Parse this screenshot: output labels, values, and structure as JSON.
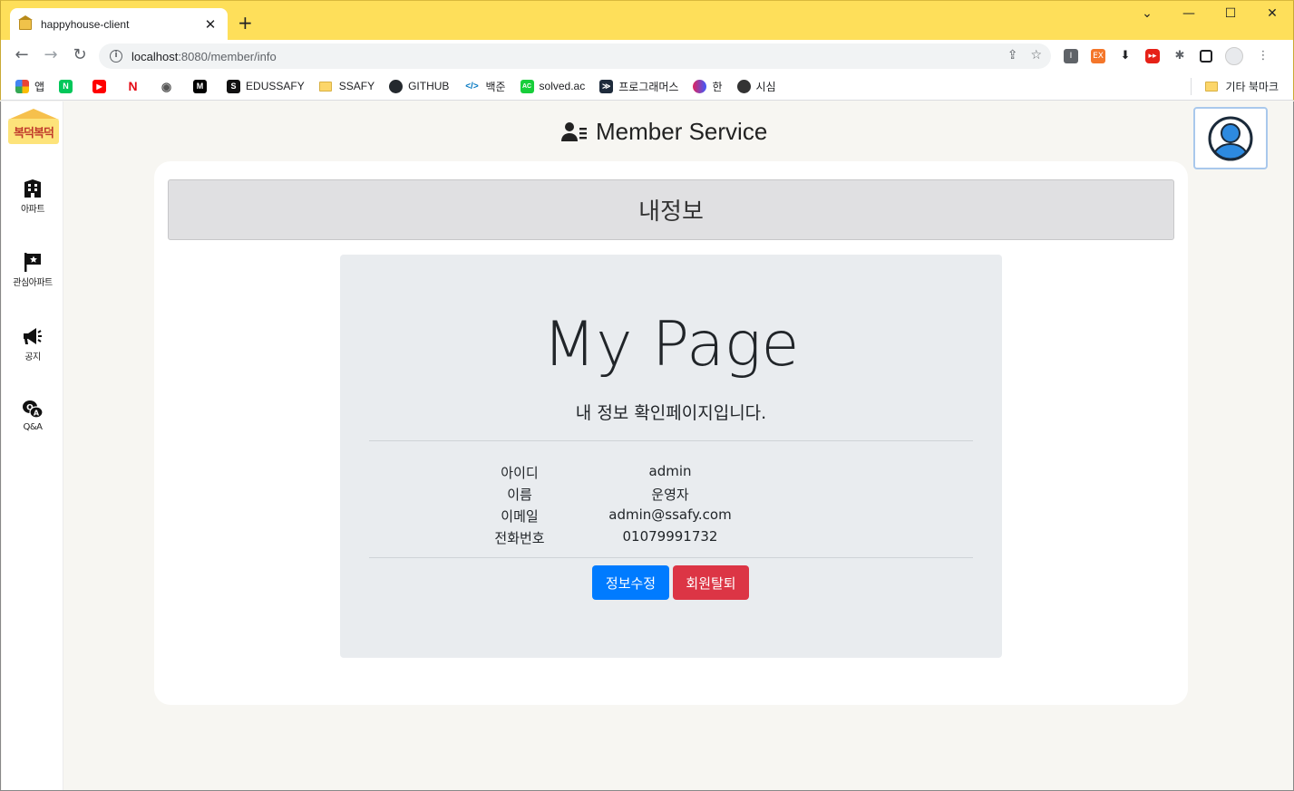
{
  "browser": {
    "tab_title": "happyhouse-client",
    "tab_close": "✕",
    "new_tab": "+",
    "url_host": "localhost",
    "url_path": ":8080/member/info",
    "window": {
      "minimize": "—",
      "maximize": "☐",
      "close": "✕",
      "dropdown": "⌄"
    },
    "nav": {
      "back": "←",
      "forward": "→",
      "reload": "↻"
    }
  },
  "bookmarks": {
    "items": [
      {
        "label": "앱",
        "icon": "apps-grid-icon",
        "color": "#4285f4"
      },
      {
        "label": "",
        "icon": "naver-icon",
        "color": "#03c75a",
        "glyph": "N"
      },
      {
        "label": "",
        "icon": "youtube-icon",
        "color": "#ff0000",
        "glyph": "▶"
      },
      {
        "label": "",
        "icon": "netflix-icon",
        "color": "#e50914",
        "glyph": "N"
      },
      {
        "label": "",
        "icon": "bookmark-icon-4",
        "color": "#555555",
        "glyph": "◉"
      },
      {
        "label": "",
        "icon": "medium-icon",
        "color": "#000000",
        "glyph": "M"
      },
      {
        "label": "EDUSSAFY",
        "icon": "edussafy-icon",
        "color": "#111111",
        "glyph": "S"
      },
      {
        "label": "SSAFY",
        "icon": "folder-icon",
        "color": "#fcd66a",
        "glyph": ""
      },
      {
        "label": "GITHUB",
        "icon": "github-icon",
        "color": "#24292e",
        "glyph": "●"
      },
      {
        "label": "백준",
        "icon": "baekjoon-icon",
        "color": "#ffffff",
        "glyph": "</>"
      },
      {
        "label": "solved.ac",
        "icon": "solvedac-icon",
        "color": "#17ce3a",
        "glyph": "AC"
      },
      {
        "label": "프로그래머스",
        "icon": "programmers-icon",
        "color": "#1e2b3c",
        "glyph": "≫"
      },
      {
        "label": "한",
        "icon": "han-icon",
        "color": "#7b3fe4",
        "glyph": "●"
      },
      {
        "label": "시심",
        "icon": "globe-icon",
        "color": "#333333",
        "glyph": "◐"
      }
    ],
    "other": "기타 북마크"
  },
  "sidebar": {
    "logo_text": "복덕복덕",
    "items": [
      {
        "label": "아파트",
        "icon": "building-icon"
      },
      {
        "label": "관심아파트",
        "icon": "flag-star-icon"
      },
      {
        "label": "공지",
        "icon": "megaphone-icon"
      },
      {
        "label": "Q&A",
        "icon": "qna-chat-icon"
      }
    ]
  },
  "header": {
    "title": "Member Service",
    "icon": "user-list-icon"
  },
  "card": {
    "header": "내정보"
  },
  "jumbotron": {
    "title": "My Page",
    "lead": "내 정보 확인페이지입니다.",
    "fields": [
      {
        "label": "아이디",
        "value": "admin"
      },
      {
        "label": "이름",
        "value": "운영자"
      },
      {
        "label": "이메일",
        "value": "admin@ssafy.com"
      },
      {
        "label": "전화번호",
        "value": "01079991732"
      }
    ],
    "buttons": {
      "edit": "정보수정",
      "withdraw": "회원탈퇴"
    }
  },
  "colors": {
    "primary": "#007bff",
    "danger": "#dc3545",
    "chrome": "#fedf5a",
    "page_bg": "#f7f6f2"
  }
}
